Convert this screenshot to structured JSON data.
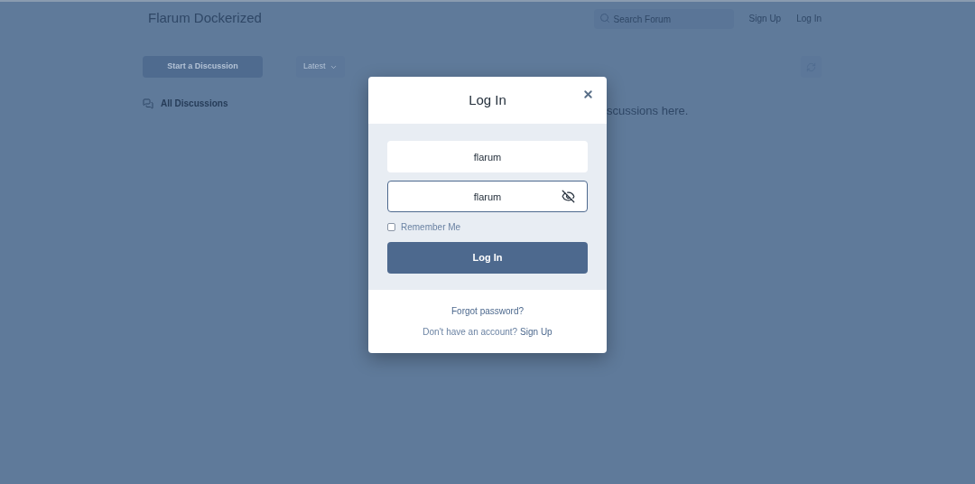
{
  "header": {
    "title": "Flarum Dockerized",
    "search": {
      "placeholder": "Search Forum"
    },
    "links": [
      "Sign Up",
      "Log In"
    ]
  },
  "toolbar": {
    "start_button": "Start a Discussion",
    "sort": "Latest"
  },
  "sidebar": {
    "items": [
      {
        "label": "All Discussions"
      }
    ]
  },
  "empty_message": "scussions here.",
  "modal": {
    "title": "Log In",
    "username": {
      "value": "flarum"
    },
    "password": {
      "value": "flarum"
    },
    "remember": {
      "label": "Remember Me",
      "checked": false
    },
    "submit": "Log In",
    "forgot": "Forgot password?",
    "signup_prompt": {
      "text": "Don't have an account?",
      "link": "Sign Up"
    }
  }
}
